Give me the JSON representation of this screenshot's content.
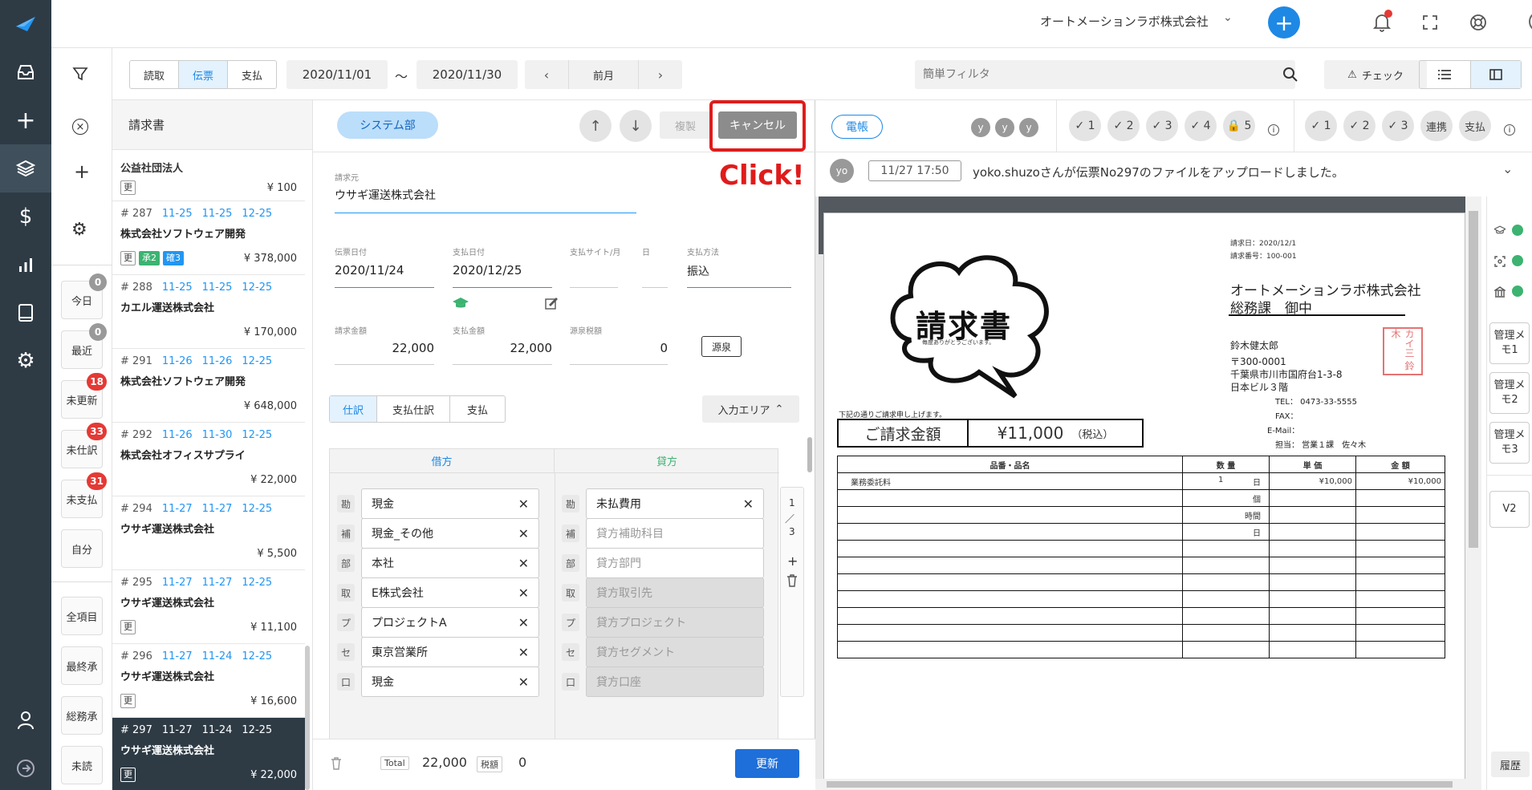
{
  "header": {
    "company": "オートメーションラボ株式会社"
  },
  "toolbar": {
    "seg_read": "読取",
    "seg_slip": "伝票",
    "seg_pay": "支払",
    "date_from": "2020/11/01",
    "tilde": "〜",
    "date_to": "2020/11/30",
    "prev_month": "前月",
    "filter_placeholder": "簡単フィルタ",
    "check_label": "チェック"
  },
  "filters": {
    "today": "今日",
    "today_count": "0",
    "recent": "最近",
    "recent_count": "0",
    "unupdated": "未更新",
    "unupdated_count": "18",
    "unjournal": "未仕訳",
    "unjournal_count": "33",
    "unpaid": "未支払",
    "unpaid_count": "31",
    "self": "自分",
    "all": "全項目",
    "final": "最終承",
    "general": "総務承",
    "unread": "未読"
  },
  "list": {
    "title": "請求書",
    "top_partial": {
      "name": "公益社団法人",
      "tag": "更",
      "amount": "¥ 100"
    },
    "items": [
      {
        "no": "# 287",
        "d1": "11-25",
        "d2": "11-25",
        "d3": "12-25",
        "name": "株式会社ソフトウェア開発",
        "tag1": "更",
        "tag2": "承2",
        "tag3": "確3",
        "amount": "¥ 378,000"
      },
      {
        "no": "# 288",
        "d1": "11-25",
        "d2": "11-25",
        "d3": "12-25",
        "name": "カエル運送株式会社",
        "amount": "¥ 170,000"
      },
      {
        "no": "# 291",
        "d1": "11-26",
        "d2": "11-26",
        "d3": "12-25",
        "name": "株式会社ソフトウェア開発",
        "amount": "¥ 648,000"
      },
      {
        "no": "# 292",
        "d1": "11-26",
        "d2": "11-30",
        "d3": "12-25",
        "name": "株式会社オフィスサプライ",
        "amount": "¥ 22,000"
      },
      {
        "no": "# 294",
        "d1": "11-27",
        "d2": "11-27",
        "d3": "12-25",
        "name": "ウサギ運送株式会社",
        "amount": "¥ 5,500"
      },
      {
        "no": "# 295",
        "d1": "11-27",
        "d2": "11-27",
        "d3": "12-25",
        "name": "ウサギ運送株式会社",
        "tag1": "更",
        "amount": "¥ 11,100"
      },
      {
        "no": "# 296",
        "d1": "11-27",
        "d2": "11-24",
        "d3": "12-25",
        "name": "ウサギ運送株式会社",
        "tag1": "更",
        "amount": "¥ 16,600"
      },
      {
        "no": "# 297",
        "d1": "11-27",
        "d2": "11-24",
        "d3": "12-25",
        "name": "ウサギ運送株式会社",
        "tag1": "更",
        "amount": "¥ 22,000"
      }
    ]
  },
  "form": {
    "department": "システム部",
    "copy": "複製",
    "cancel": "キャンセル",
    "click_annotation": "Click!",
    "issuer_label": "請求元",
    "issuer": "ウサギ運送株式会社",
    "slip_date_label": "伝票日付",
    "slip_date": "2020/11/24",
    "pay_date_label": "支払日付",
    "pay_date": "2020/12/25",
    "pay_site_label": "支払サイト/月",
    "day_label": "日",
    "method_label": "支払方法",
    "method": "振込",
    "bill_amount_label": "請求金額",
    "bill_amount": "22,000",
    "pay_amount_label": "支払金額",
    "pay_amount": "22,000",
    "withholding_label": "源泉税額",
    "withholding": "0",
    "withholding_btn": "源泉",
    "tab_journal": "仕訳",
    "tab_pay_journal": "支払仕訳",
    "tab_pay": "支払",
    "input_area": "入力エリア",
    "debit_title": "借方",
    "credit_title": "貸方",
    "page_top": "1",
    "page_sep": "／",
    "page_bottom": "3",
    "debit": [
      {
        "badge": "勘",
        "value": "現金"
      },
      {
        "badge": "補",
        "value": "現金_その他"
      },
      {
        "badge": "部",
        "value": "本社"
      },
      {
        "badge": "取",
        "value": "E株式会社"
      },
      {
        "badge": "プ",
        "value": "プロジェクトA"
      },
      {
        "badge": "セ",
        "value": "東京営業所"
      },
      {
        "badge": "口",
        "value": "現金"
      }
    ],
    "credit": [
      {
        "badge": "勘",
        "value": "未払費用"
      },
      {
        "badge": "補",
        "placeholder": "貸方補助科目"
      },
      {
        "badge": "部",
        "placeholder": "貸方部門"
      },
      {
        "badge": "取",
        "placeholder": "貸方取引先"
      },
      {
        "badge": "プ",
        "placeholder": "貸方プロジェクト"
      },
      {
        "badge": "セ",
        "placeholder": "貸方セグメント"
      },
      {
        "badge": "口",
        "placeholder": "貸方口座"
      }
    ],
    "total_label": "Total",
    "total": "22,000",
    "tax_label": "税額",
    "tax": "0",
    "update": "更新"
  },
  "right": {
    "ledger": "電帳",
    "avatar_y": "y",
    "checks_a": [
      "1",
      "2",
      "3",
      "4",
      "5"
    ],
    "checks_b": [
      "1",
      "2",
      "3"
    ],
    "link": "連携",
    "pay": "支払",
    "log_avatar": "yo",
    "log_time": "11/27 17:50",
    "log_text": "yoko.shuzoさんが伝票No297のファイルをアップロードしました。",
    "memo1": "管理メモ1",
    "memo2": "管理メモ2",
    "memo3": "管理メモ3",
    "v2": "V2",
    "history": "履歴"
  },
  "invoice": {
    "title": "請求書",
    "thanks": "毎度ありがとうございます。",
    "date": "請求日：2020/12/1",
    "number": "請求番号：100-001",
    "to_company": "オートメーションラボ株式会社",
    "to_dept": "総務課　御中",
    "from_name": "鈴木健太郎",
    "zip": "〒300-0001",
    "addr1": "千葉県市川市国府台1-3-8",
    "addr2": "日本ビル３階",
    "tel": "TEL： 0473-33-5555",
    "fax": "FAX：",
    "email": "E-Mail：",
    "rep": "担当： 営業１課　佐々木",
    "stamp": "カイ三 鈴木",
    "note": "下記の通りご請求申し上げます。",
    "amount_label": "ご請求金額",
    "amount": "¥11,000",
    "tax_note": "（税込）",
    "col_item": "品番・品名",
    "col_qty": "数 量",
    "col_unit": "単 価",
    "col_amount": "金 額",
    "row1_item": "業務委託料",
    "row1_qty": "1",
    "row1_unit_word": "日",
    "row1_price": "¥10,000",
    "row1_amount": "¥10,000",
    "unit_piece": "個",
    "unit_hour": "時間",
    "unit_day": "日"
  }
}
